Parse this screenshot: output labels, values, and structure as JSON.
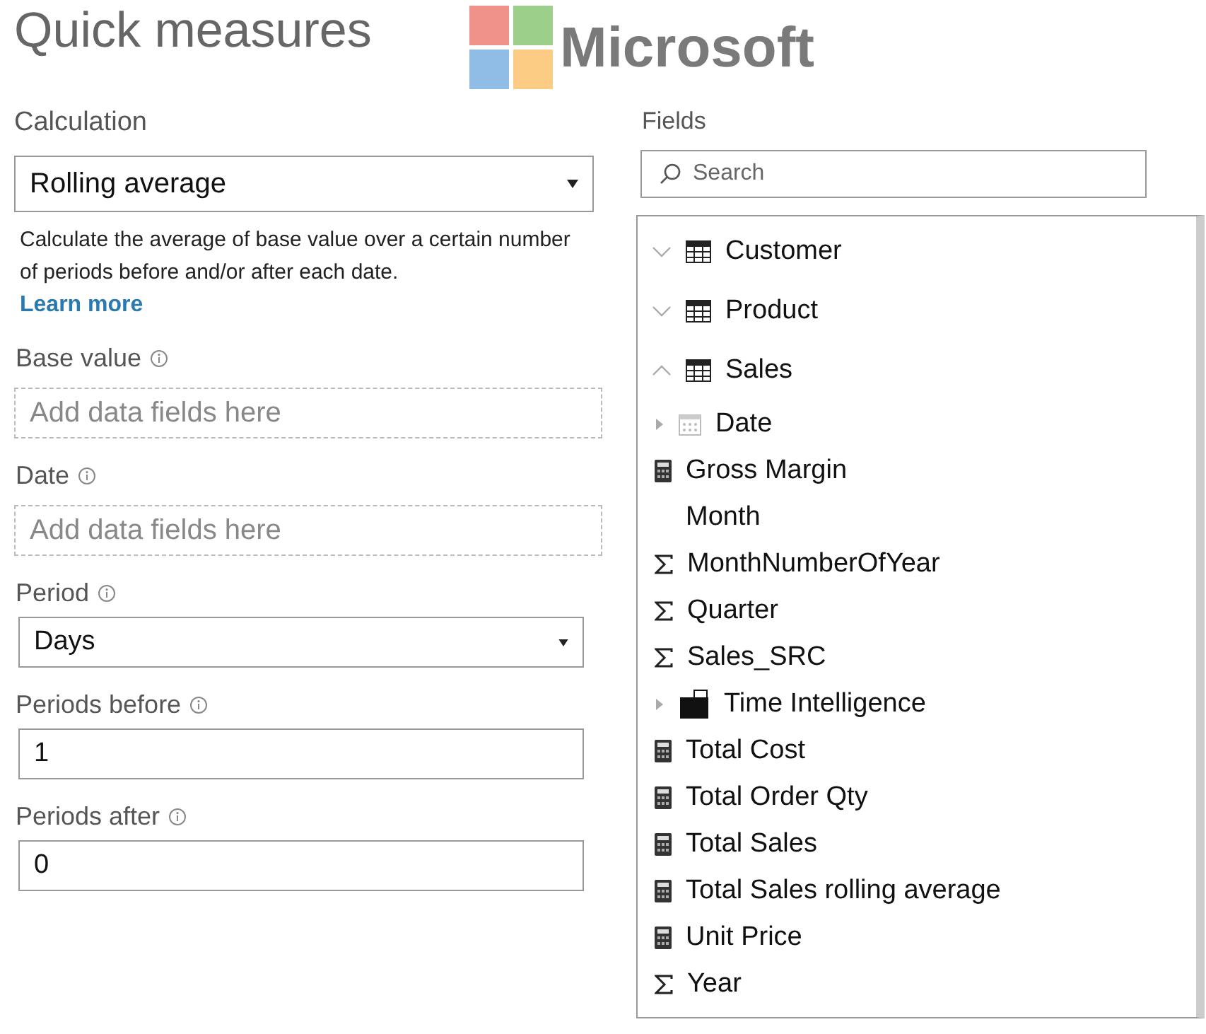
{
  "title": "Quick measures",
  "logo": {
    "text": "Microsoft"
  },
  "calculation": {
    "label": "Calculation",
    "value": "Rolling average",
    "description": "Calculate the average of base value over a certain number of periods before and/or after each date.",
    "link": "Learn more"
  },
  "base_value": {
    "label": "Base value",
    "placeholder": "Add data fields here"
  },
  "date": {
    "label": "Date",
    "placeholder": "Add data fields here"
  },
  "period": {
    "label": "Period",
    "value": "Days"
  },
  "periods_before": {
    "label": "Periods before",
    "value": "1"
  },
  "periods_after": {
    "label": "Periods after",
    "value": "0"
  },
  "fields": {
    "label": "Fields",
    "search": {
      "placeholder": "Search"
    },
    "items": [
      {
        "kind": "table",
        "name": "Customer",
        "expanded": false
      },
      {
        "kind": "table",
        "name": "Product",
        "expanded": false
      },
      {
        "kind": "table",
        "name": "Sales",
        "expanded": true,
        "children": [
          {
            "kind": "date",
            "name": "Date",
            "expanded": false
          },
          {
            "kind": "measure",
            "name": "Gross Margin"
          },
          {
            "kind": "column",
            "name": "Month"
          },
          {
            "kind": "sum",
            "name": "MonthNumberOfYear"
          },
          {
            "kind": "sum",
            "name": "Quarter"
          },
          {
            "kind": "sum",
            "name": "Sales_SRC"
          },
          {
            "kind": "folder",
            "name": "Time Intelligence",
            "expanded": false
          },
          {
            "kind": "measure",
            "name": "Total Cost"
          },
          {
            "kind": "measure",
            "name": "Total Order Qty"
          },
          {
            "kind": "measure",
            "name": "Total Sales"
          },
          {
            "kind": "measure",
            "name": "Total Sales rolling average"
          },
          {
            "kind": "measure",
            "name": "Unit Price"
          },
          {
            "kind": "sum",
            "name": "Year"
          }
        ]
      }
    ]
  }
}
